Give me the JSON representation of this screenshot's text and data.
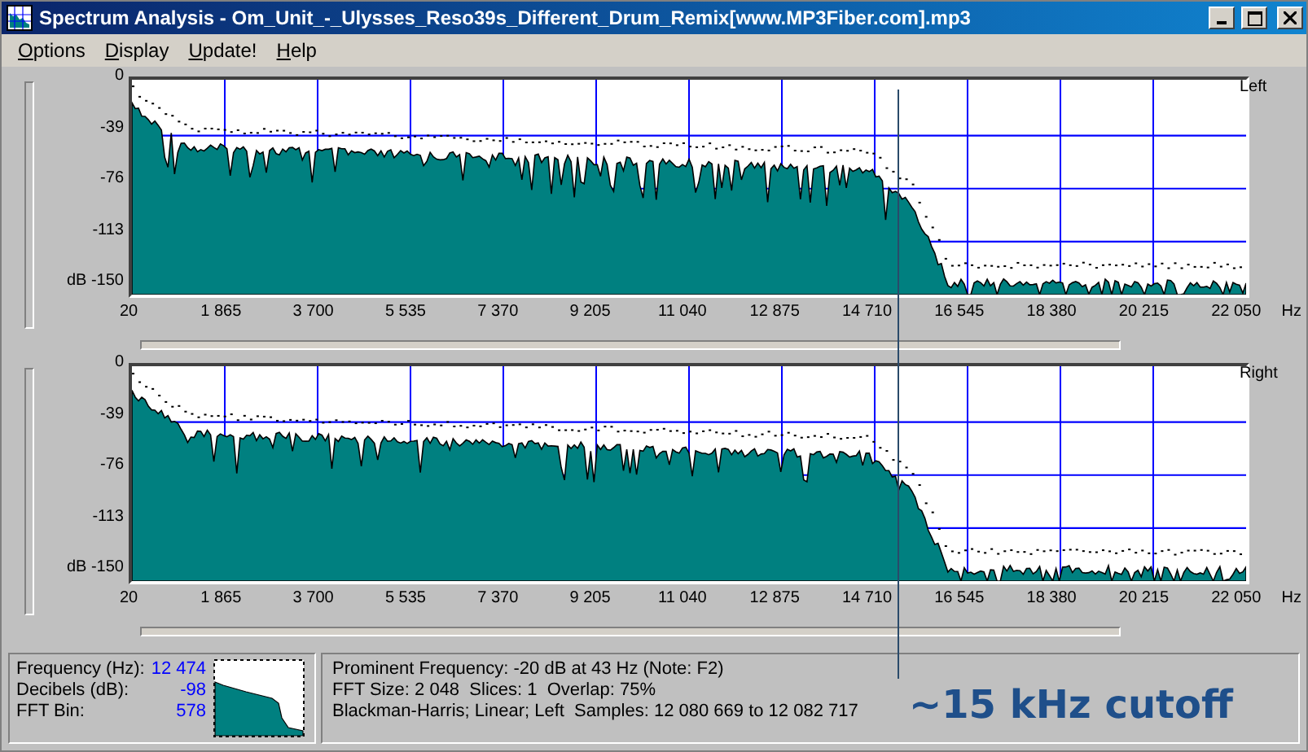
{
  "window": {
    "title": "Spectrum Analysis - Om_Unit_-_Ulysses_Reso39s_Different_Drum_Remix[www.MP3Fiber.com].mp3"
  },
  "menu": [
    "Options",
    "Display",
    "Update!",
    "Help"
  ],
  "charts": [
    {
      "channel": "Left",
      "y_ticks": [
        "0",
        "-39",
        "-76",
        "-113",
        "dB -150"
      ],
      "x_ticks": [
        "20",
        "1 865",
        "3 700",
        "5 535",
        "7 370",
        "9 205",
        "11 040",
        "12 875",
        "14 710",
        "16 545",
        "18 380",
        "20 215",
        "22 050"
      ],
      "x_unit": "Hz"
    },
    {
      "channel": "Right",
      "y_ticks": [
        "0",
        "-39",
        "-76",
        "-113",
        "dB -150"
      ],
      "x_ticks": [
        "20",
        "1 865",
        "3 700",
        "5 535",
        "7 370",
        "9 205",
        "11 040",
        "12 875",
        "14 710",
        "16 545",
        "18 380",
        "20 215",
        "22 050"
      ],
      "x_unit": "Hz"
    }
  ],
  "readout": [
    {
      "label": "Frequency (Hz):",
      "value": "12 474"
    },
    {
      "label": "Decibels (dB):",
      "value": "-98"
    },
    {
      "label": "FFT Bin:",
      "value": "578"
    }
  ],
  "info": [
    "Prominent Frequency: -20 dB at 43 Hz (Note: F2)",
    "FFT Size: 2 048  Slices: 1  Overlap: 75%",
    "Blackman-Harris; Linear; Left  Samples: 12 080 669 to 12 082 717"
  ],
  "annotation": {
    "text": "~15 kHz cutoff"
  }
}
